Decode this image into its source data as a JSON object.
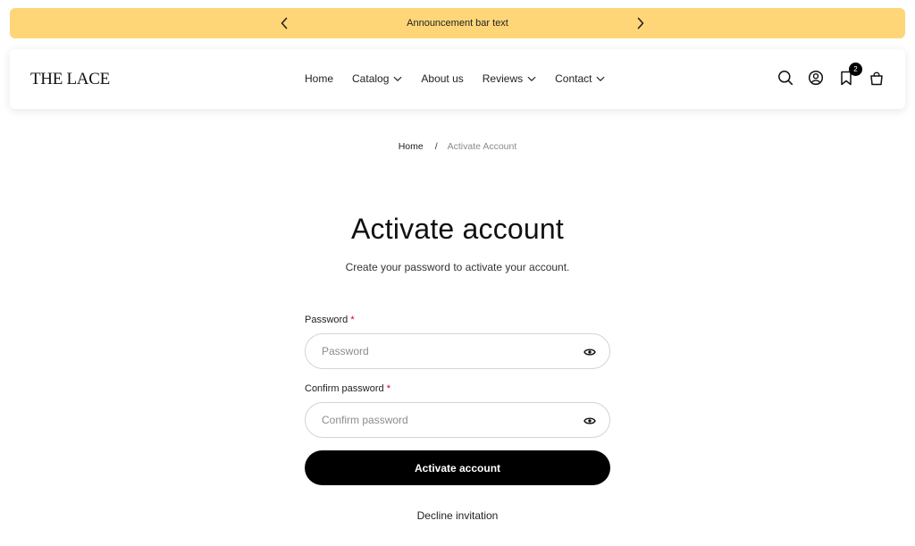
{
  "announcement": {
    "text": "Announcement bar text",
    "prev_icon": "chevron-left-icon",
    "next_icon": "chevron-right-icon",
    "background": "#fed678"
  },
  "header": {
    "logo": "THE LACE",
    "nav": [
      {
        "label": "Home",
        "dropdown": false
      },
      {
        "label": "Catalog",
        "dropdown": true
      },
      {
        "label": "About us",
        "dropdown": false
      },
      {
        "label": "Reviews",
        "dropdown": true
      },
      {
        "label": "Contact",
        "dropdown": true
      }
    ],
    "icons": [
      "search-icon",
      "account-icon",
      "wishlist-icon",
      "cart-icon"
    ],
    "wishlist_count": "2"
  },
  "breadcrumb": {
    "home": "Home",
    "separator": "/",
    "current": "Activate Account"
  },
  "page": {
    "title": "Activate account",
    "subtitle": "Create your password to activate your account."
  },
  "form": {
    "password": {
      "label": "Password",
      "required_mark": "*",
      "placeholder": "Password",
      "value": ""
    },
    "confirm": {
      "label": "Confirm password",
      "required_mark": "*",
      "placeholder": "Confirm password",
      "value": ""
    },
    "submit_label": "Activate account",
    "decline_label": "Decline invitation",
    "required_color": "#d0021b"
  }
}
